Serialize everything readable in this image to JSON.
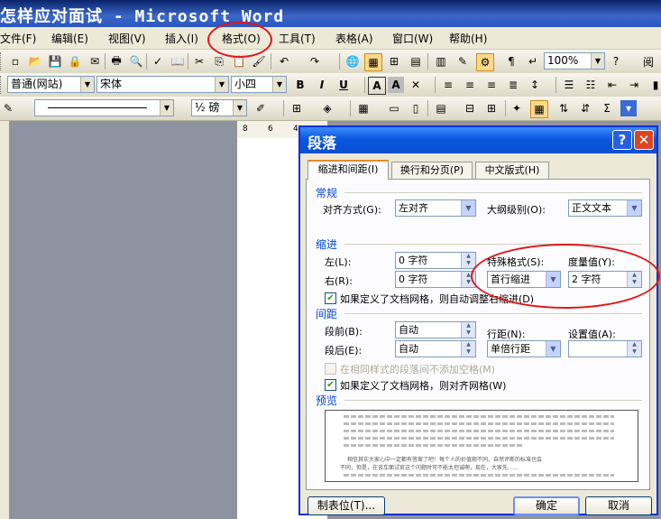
{
  "window": {
    "title": "怎样应对面试 - Microsoft Word"
  },
  "menu": [
    "文件(F)",
    "编辑(E)",
    "视图(V)",
    "插入(I)",
    "格式(O)",
    "工具(T)",
    "表格(A)",
    "窗口(W)",
    "帮助(H)"
  ],
  "toolbar1": {
    "zoom": "100%",
    "reading": "阅"
  },
  "toolbar2": {
    "style": "普通(网站)",
    "font": "宋体",
    "size": "小四",
    "bold": "B",
    "italic": "I",
    "underline": "U",
    "charborder": "A",
    "charshade": "A"
  },
  "toolbar3": {
    "line_weight": "½ 磅",
    "sigma": "Σ"
  },
  "ruler": {
    "marks": [
      "8",
      "6",
      "4"
    ]
  },
  "dialog": {
    "title": "段落",
    "help": "?",
    "close": "✕",
    "tabs": [
      "缩进和间距(I)",
      "换行和分页(P)",
      "中文版式(H)"
    ],
    "general": {
      "section": "常规",
      "align_label": "对齐方式(G):",
      "align_value": "左对齐",
      "outline_label": "大纲级别(O):",
      "outline_value": "正文文本"
    },
    "indent": {
      "section": "缩进",
      "left_label": "左(L):",
      "left_value": "0 字符",
      "right_label": "右(R):",
      "right_value": "0 字符",
      "special_label": "特殊格式(S):",
      "special_value": "首行缩进",
      "by_label": "度量值(Y):",
      "by_value": "2 字符",
      "grid_check": "如果定义了文档网格，则自动调整右缩进(D)"
    },
    "spacing": {
      "section": "间距",
      "before_label": "段前(B):",
      "before_value": "自动",
      "after_label": "段后(E):",
      "after_value": "自动",
      "line_label": "行距(N):",
      "line_value": "单倍行距",
      "at_label": "设置值(A):",
      "at_value": "",
      "no_space_check": "在相同样式的段落间不添加空格(M)",
      "snap_check": "如果定义了文档网格，则对齐网格(W)"
    },
    "preview": {
      "section": "预览",
      "text1": "相信其实大家心中一定都有答案了吧！每个人的价值观不同，自然评断的标准也会",
      "text2": "不同，但是，在谈车面试官这个问题时可不能太坦诚啊，现在，大家先……"
    },
    "buttons": {
      "tabs": "制表位(T)...",
      "ok": "确定",
      "cancel": "取消"
    }
  },
  "annotations": {
    "color": "#e0161a"
  }
}
